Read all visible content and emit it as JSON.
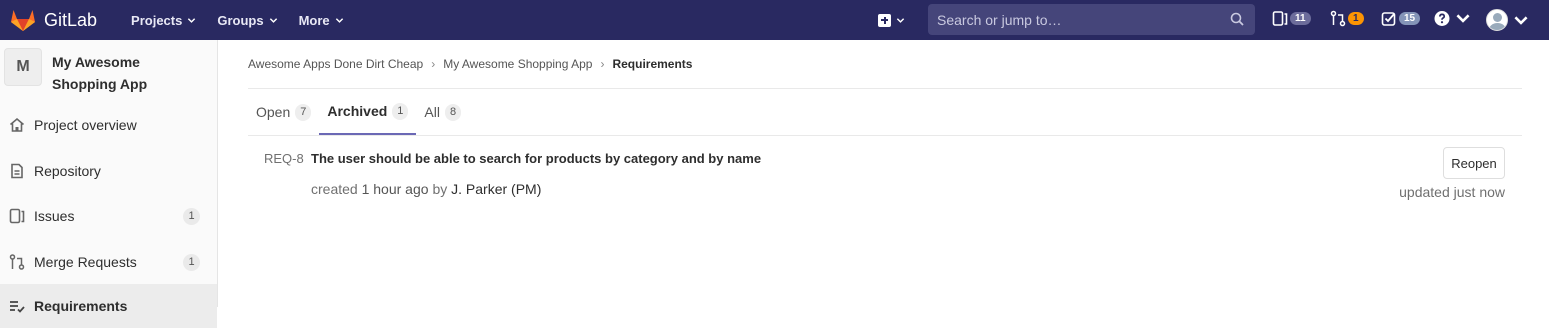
{
  "navbar": {
    "brand": "GitLab",
    "menu": [
      {
        "label": "Projects"
      },
      {
        "label": "Groups"
      },
      {
        "label": "More"
      }
    ],
    "search_placeholder": "Search or jump to…",
    "issues_count": "11",
    "merge_requests_count": "1",
    "todos_count": "15"
  },
  "sidebar": {
    "project_initial": "M",
    "project_name": "My Awesome Shopping App",
    "items": [
      {
        "label": "Project overview",
        "icon": "home-icon"
      },
      {
        "label": "Repository",
        "icon": "doc-icon"
      },
      {
        "label": "Issues",
        "icon": "issues-icon",
        "count": "1"
      },
      {
        "label": "Merge Requests",
        "icon": "merge-request-icon",
        "count": "1"
      },
      {
        "label": "Requirements",
        "icon": "requirements-icon"
      }
    ]
  },
  "breadcrumbs": [
    "Awesome Apps Done Dirt Cheap",
    "My Awesome Shopping App",
    "Requirements"
  ],
  "tabs": [
    {
      "label": "Open",
      "count": "7"
    },
    {
      "label": "Archived",
      "count": "1"
    },
    {
      "label": "All",
      "count": "8"
    }
  ],
  "requirement": {
    "ref": "REQ-8",
    "title": "The user should be able to search for products by category and by name",
    "created_prefix": "created",
    "created_time": "1 hour ago",
    "by": "by",
    "author": "J. Parker (PM)",
    "action_label": "Reopen",
    "updated": "updated just now"
  },
  "colors": {
    "navbar_bg": "#292961",
    "brand_orange": "#fc6d26",
    "active_tab_underline": "#6b68b5"
  }
}
